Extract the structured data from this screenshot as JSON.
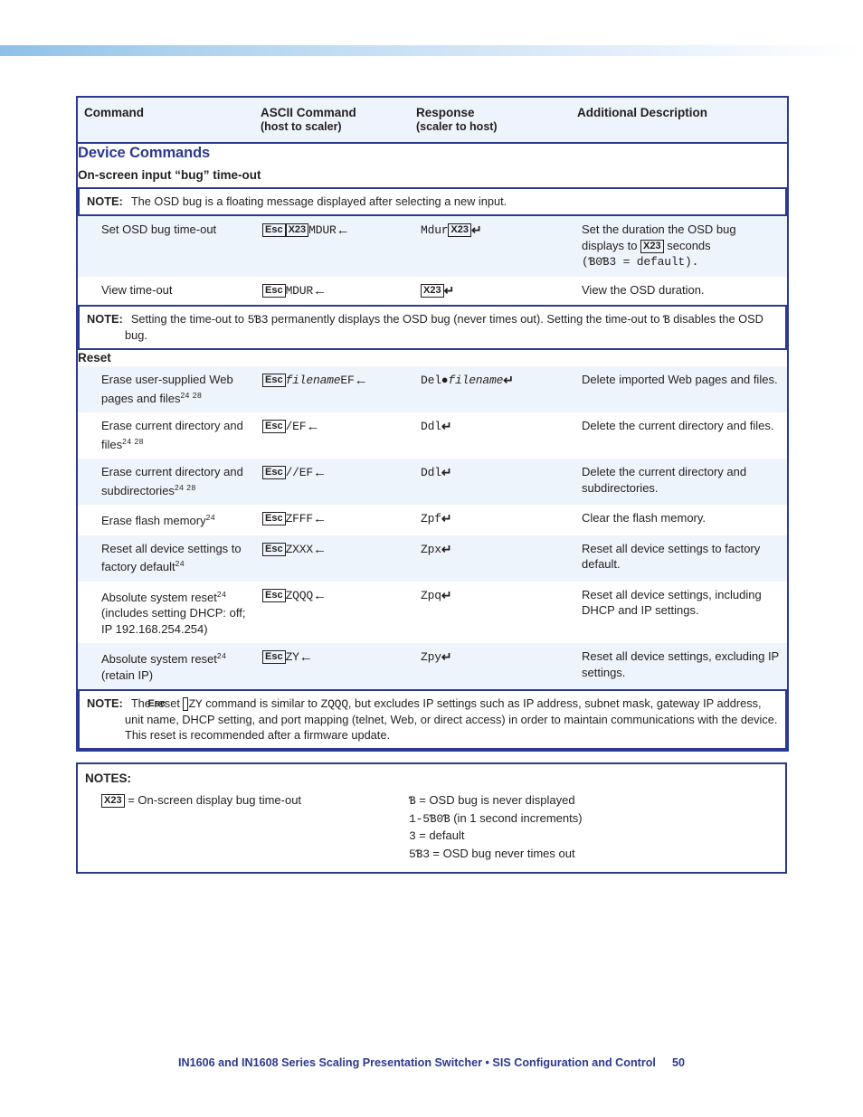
{
  "table": {
    "headers": {
      "command": "Command",
      "ascii": "ASCII Command",
      "ascii_sub": "(host to scaler)",
      "response": "Response",
      "response_sub": "(scaler to host)",
      "description": "Additional Description"
    },
    "section_device": "Device Commands",
    "subsection_osd": "On-screen input “bug” time-out",
    "section_reset": "Reset",
    "note_label": "NOTE:",
    "note_osd_bug": "The OSD bug is a floating message displayed after selecting a new input.",
    "note_timeout": {
      "part1": "Setting the time-out to ",
      "code1": "5Ɓ3",
      "part2": " permanently displays the OSD bug (never times out). Setting the time-out to ",
      "code2": "Ɓ",
      "part3": " disables the OSD bug."
    },
    "note_reset": {
      "part1": "The reset ",
      "key": "Esc",
      "code1": "ZY",
      "part2": " command is similar to ",
      "code2": "ZQQQ",
      "part3": ", but excludes IP settings such as IP address, subnet mask, gateway IP address, unit name, DHCP setting, and port mapping (telnet, Web, or direct access) in order to maintain communications with the device. This reset is recommended after a firmware update."
    },
    "rows": [
      {
        "command": "Set OSD bug time-out",
        "ascii": {
          "key": "Esc",
          "var": "X23",
          "code": "MDUR",
          "arrow": "←"
        },
        "response": {
          "code": "Mdur",
          "var": "X23",
          "ret": "↵"
        },
        "desc_a": "Set the duration the OSD bug displays to ",
        "desc_var": "X23",
        "desc_b": " seconds",
        "desc_c": "(Ɓ0Ɓ3 = default).",
        "shaded": true
      },
      {
        "command": "View time-out",
        "ascii": {
          "key": "Esc",
          "code": "MDUR",
          "arrow": "←"
        },
        "response": {
          "var": "X23",
          "ret": "↵"
        },
        "desc_a": "View the OSD duration.",
        "shaded": false
      },
      {
        "command": "Erase user-supplied Web pages and files",
        "footnotes": "24 28",
        "ascii": {
          "key": "Esc",
          "italic": "filename",
          "code": "EF",
          "arrow": "←"
        },
        "response": {
          "code": "Del●",
          "italic": "filename",
          "ret": "↵"
        },
        "desc_a": "Delete imported Web pages and files.",
        "shaded": true
      },
      {
        "command": "Erase current directory and files",
        "footnotes": "24 28",
        "ascii": {
          "key": "Esc",
          "code": "/EF",
          "arrow": "←"
        },
        "response": {
          "code": "Ddl",
          "ret": "↵"
        },
        "desc_a": "Delete the current directory and files.",
        "shaded": false
      },
      {
        "command": "Erase current directory and subdirectories",
        "footnotes": "24 28",
        "ascii": {
          "key": "Esc",
          "code": "//EF",
          "arrow": "←"
        },
        "response": {
          "code": "Ddl",
          "ret": "↵"
        },
        "desc_a": "Delete the current directory and subdirectories.",
        "shaded": true
      },
      {
        "command": "Erase flash memory",
        "footnotes": "24",
        "ascii": {
          "key": "Esc",
          "code": "ZFFF",
          "arrow": "←"
        },
        "response": {
          "code": "Zpf",
          "ret": "↵"
        },
        "desc_a": "Clear the flash memory.",
        "shaded": false
      },
      {
        "command": "Reset all device settings to factory default",
        "footnotes": "24",
        "ascii": {
          "key": "Esc",
          "code": "ZXXX",
          "arrow": "←"
        },
        "response": {
          "code": "Zpx",
          "ret": "↵"
        },
        "desc_a": "Reset all device settings to factory default.",
        "shaded": true
      },
      {
        "command": "Absolute system reset",
        "footnotes": "24",
        "command_tail": " (includes setting DHCP: off; IP 192.168.254.254)",
        "ascii": {
          "key": "Esc",
          "code": "ZQQQ",
          "arrow": "←"
        },
        "response": {
          "code": "Zpq",
          "ret": "↵"
        },
        "desc_a": "Reset all device settings, including DHCP and IP settings.",
        "shaded": false
      },
      {
        "command": "Absolute system reset",
        "footnotes": "24",
        "command_tail": " (retain IP)",
        "ascii": {
          "key": "Esc",
          "code": "ZY",
          "arrow": "←"
        },
        "response": {
          "code": "Zpy",
          "ret": "↵"
        },
        "desc_a": "Reset all device settings, excluding IP settings.",
        "shaded": true
      }
    ]
  },
  "notes": {
    "title": "NOTES:",
    "var_label": "X23",
    "var_desc": "= On-screen display bug time-out",
    "values": [
      {
        "code": "Ɓ",
        "text": " = OSD bug is never displayed"
      },
      {
        "code": "1-5Ɓ0Ɓ",
        "text": " (in 1 second increments)"
      },
      {
        "code": "3",
        "text": " = default"
      },
      {
        "code": "5Ɓ3",
        "text": " = OSD bug never times out"
      }
    ]
  },
  "footer": {
    "text": "IN1606 and IN1608 Series Scaling Presentation Switcher • SIS Configuration and Control",
    "page": "50"
  }
}
